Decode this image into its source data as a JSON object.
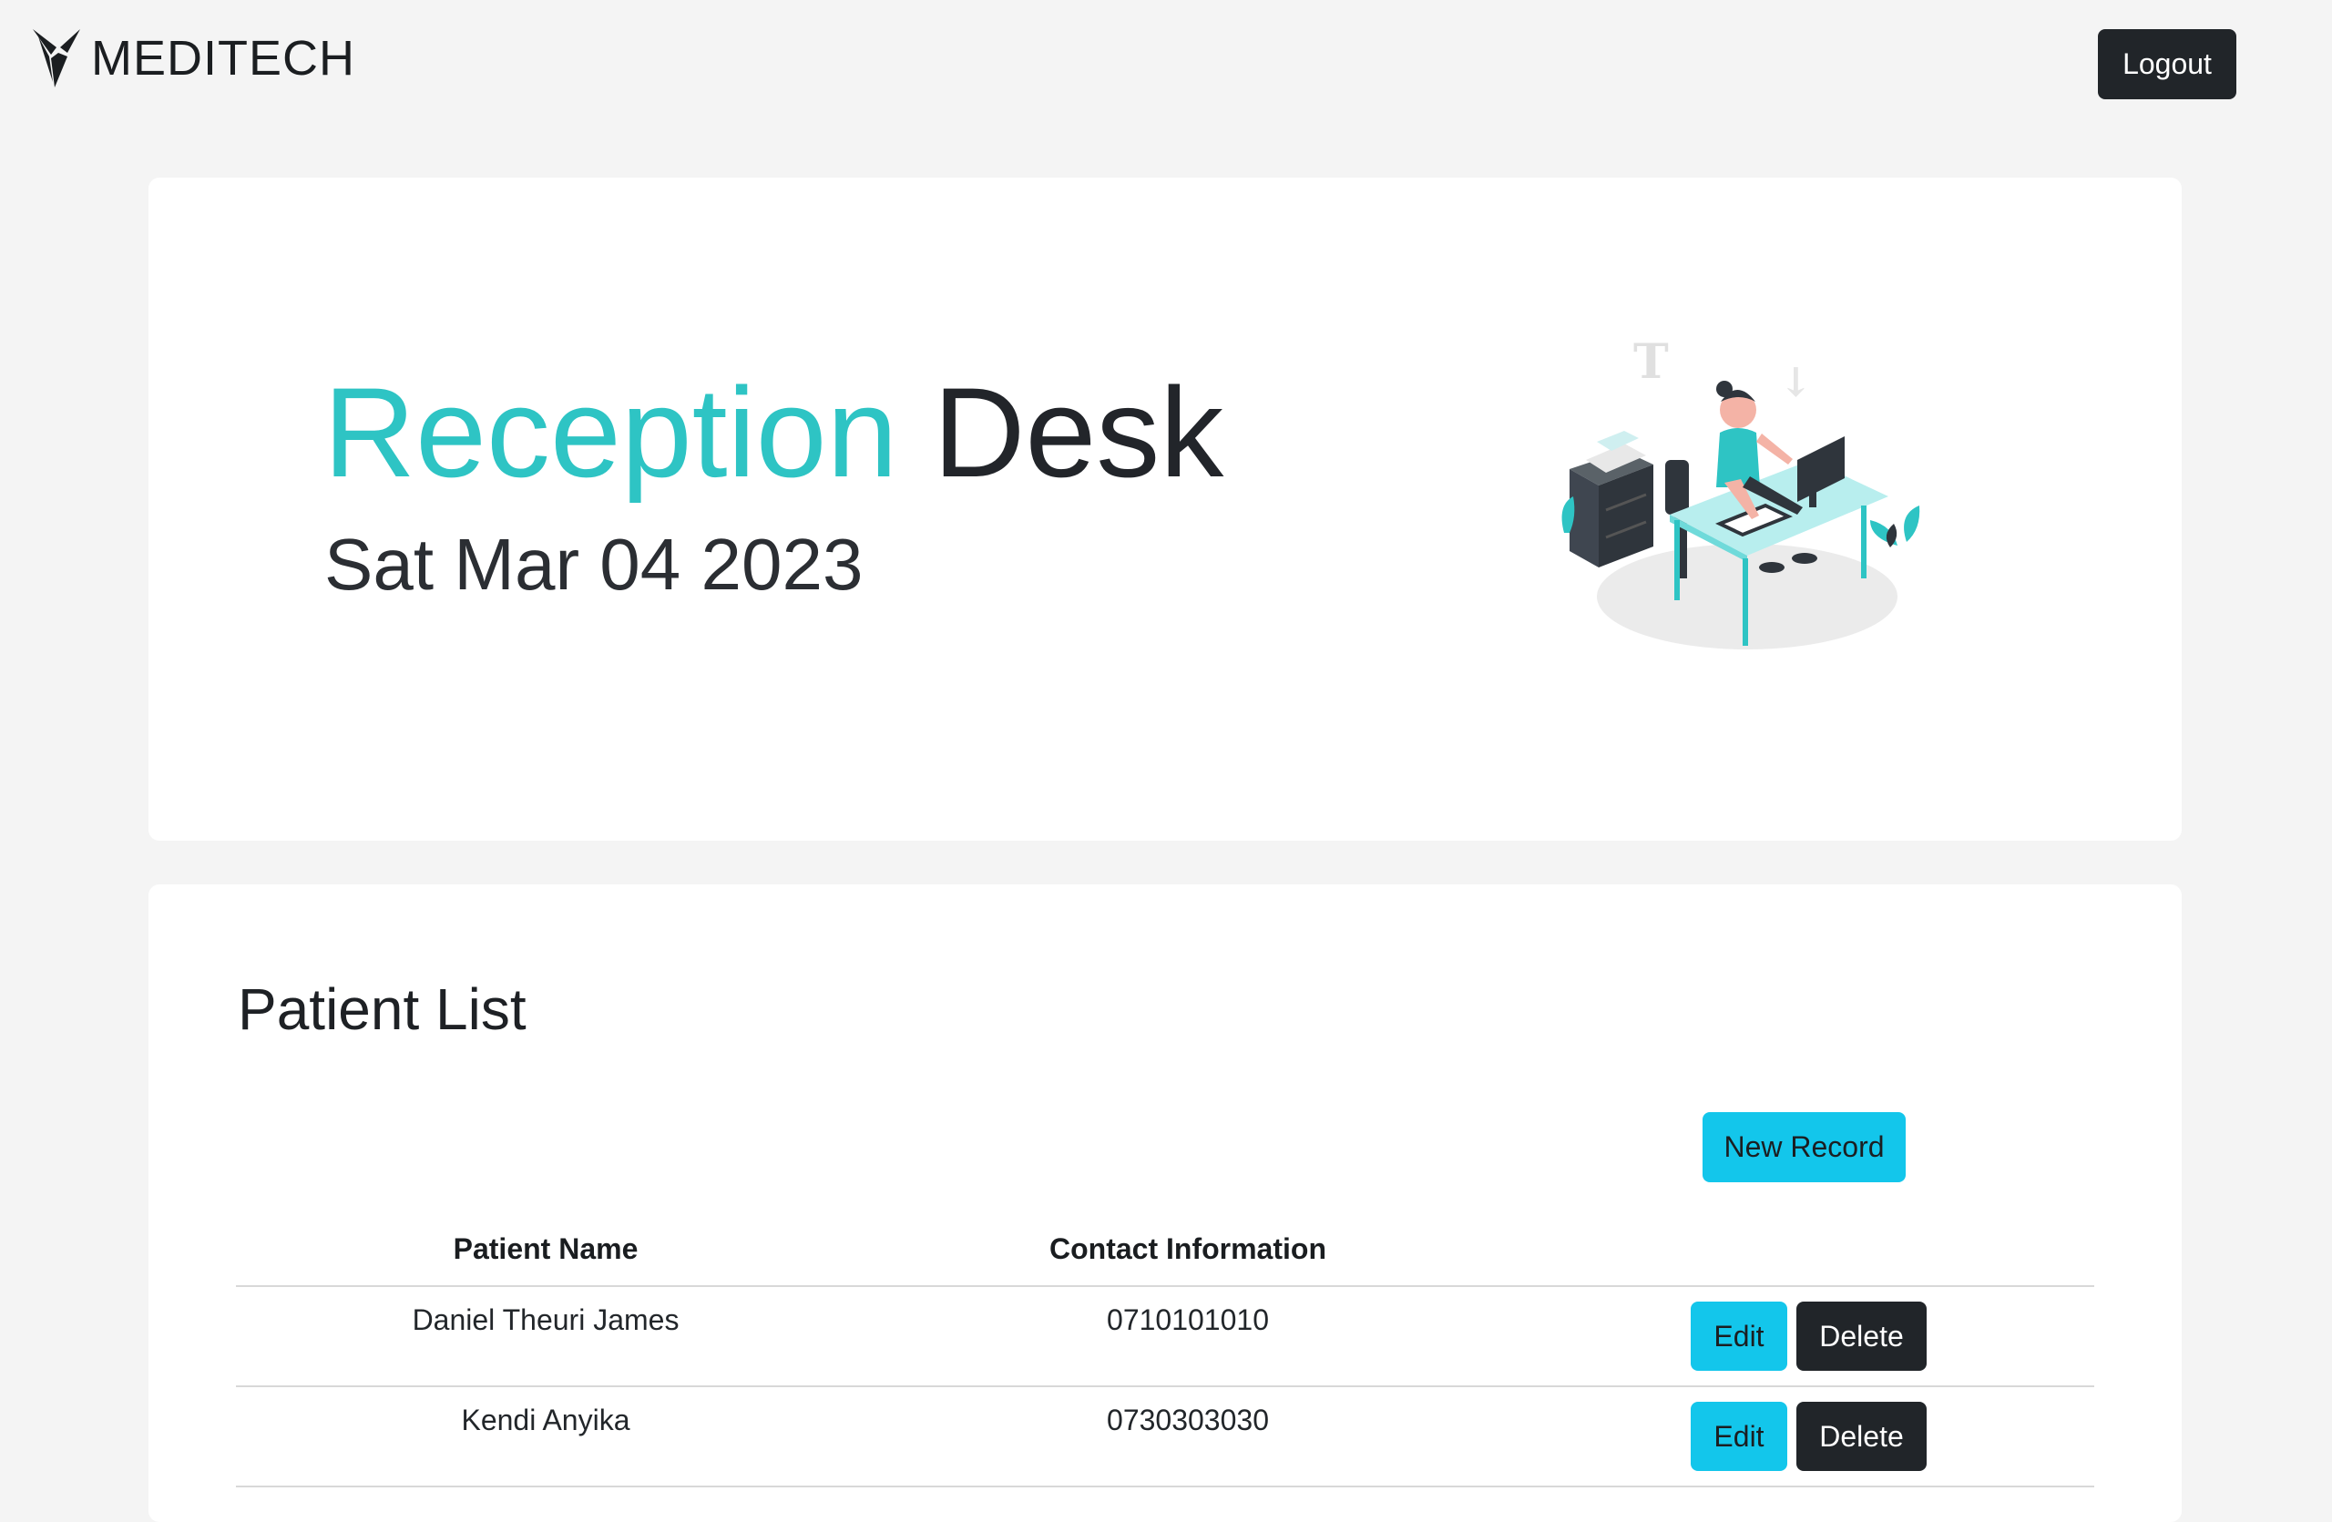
{
  "brand": {
    "name": "MEDITECH",
    "icon": "meditech-logo"
  },
  "header": {
    "logout_label": "Logout"
  },
  "hero": {
    "title_accent": "Reception",
    "title_rest": "Desk",
    "date": "Sat Mar 04 2023",
    "illustration": "receptionist-at-desk-illustration",
    "accent_color": "#2ec4c4"
  },
  "patients": {
    "title": "Patient List",
    "new_record_label": "New Record",
    "columns": [
      "Patient Name",
      "Contact Information"
    ],
    "rows": [
      {
        "name": "Daniel Theuri James",
        "contact": "0710101010",
        "edit_label": "Edit",
        "delete_label": "Delete"
      },
      {
        "name": "Kendi Anyika",
        "contact": "0730303030",
        "edit_label": "Edit",
        "delete_label": "Delete"
      }
    ]
  },
  "colors": {
    "primary_button": "#13c6eb",
    "dark_button": "#212529",
    "background": "#f4f4f4"
  }
}
